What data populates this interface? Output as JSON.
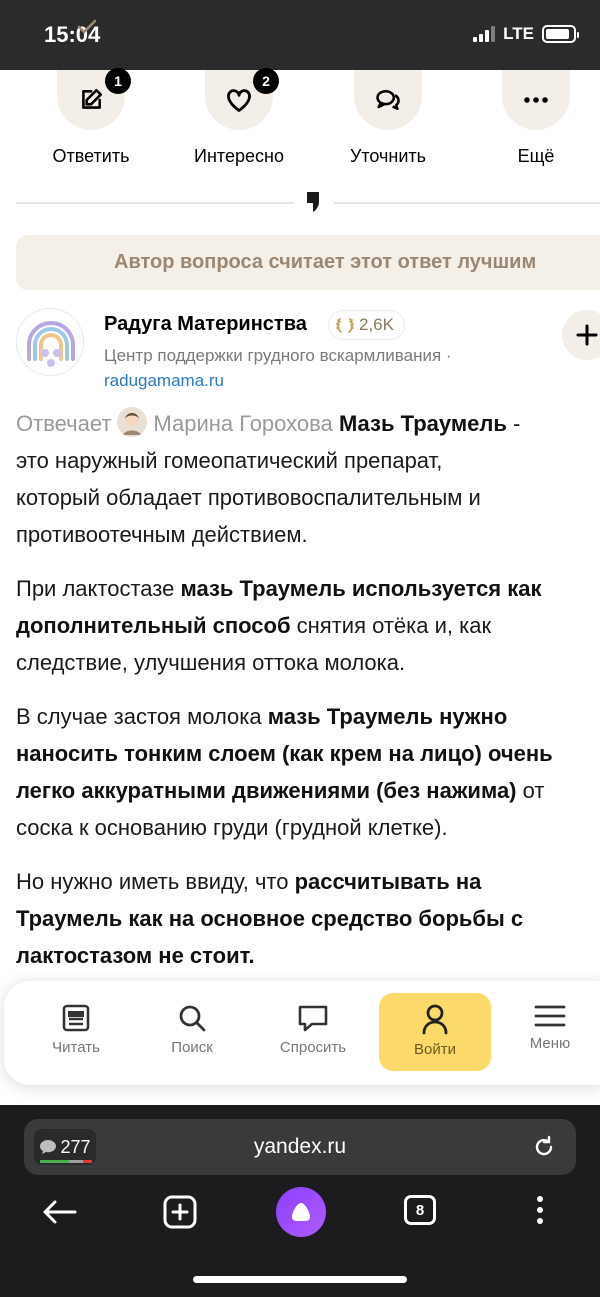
{
  "status_bar": {
    "time": "15:04",
    "network": "LTE",
    "battery_level": 0.9
  },
  "actions": [
    {
      "label": "Ответить",
      "icon": "edit-icon",
      "badge": "1"
    },
    {
      "label": "Интересно",
      "icon": "heart-icon",
      "badge": "2"
    },
    {
      "label": "Уточнить",
      "icon": "chat-bubbles-icon",
      "badge": ""
    },
    {
      "label": "Ещё",
      "icon": "more-dots-icon",
      "badge": ""
    }
  ],
  "best_answer": {
    "text": "Автор вопроса считает этот ответ лучшим"
  },
  "author": {
    "name": "Радуга Материнства",
    "rating": "2,6K",
    "description": "Центр поддержки грудного вскармливания ·",
    "link": "radugamama.ru"
  },
  "article": {
    "p1": {
      "answering": "Отвечает",
      "expert": "Марина Горохова",
      "bold": "Мазь Траумель",
      "l1_rest": " -",
      "l2": "это наружный гомеопатический препарат,",
      "l3": "который обладает противовоспалительным и",
      "l4": "противоотечным действием."
    },
    "p2": {
      "l1_a": "При лактостазе ",
      "l1_b": "мазь Траумель используется как",
      "l2_a": "дополнительный способ",
      "l2_b": " снятия отёка и, как",
      "l3": "следствие, улучшения оттока молока."
    },
    "p3": {
      "l1_a": "В случае застоя молока ",
      "l1_b": "мазь Траумель нужно",
      "l2": "наносить тонким слоем (как крем на лицо) очень",
      "l3_b": "легко аккуратными движениями (без нажима)",
      "l3_c": " от",
      "l4": "соска к основанию груди (грудной клетке)."
    },
    "p4": {
      "l1_a": "Но нужно иметь ввиду, что ",
      "l1_b": "рассчитывать на",
      "l2": "Траумель как на основное средство борьбы с",
      "l3": "лактостазом не стоит."
    }
  },
  "tabbar": [
    {
      "label": "Читать",
      "icon": "read-icon"
    },
    {
      "label": "Поиск",
      "icon": "search-icon"
    },
    {
      "label": "Спросить",
      "icon": "ask-icon"
    },
    {
      "label": "Войти",
      "icon": "user-icon"
    },
    {
      "label": "Меню",
      "icon": "menu-icon"
    }
  ],
  "browser": {
    "comments_count": "277",
    "url": "yandex.ru",
    "tabs_count": "8"
  }
}
